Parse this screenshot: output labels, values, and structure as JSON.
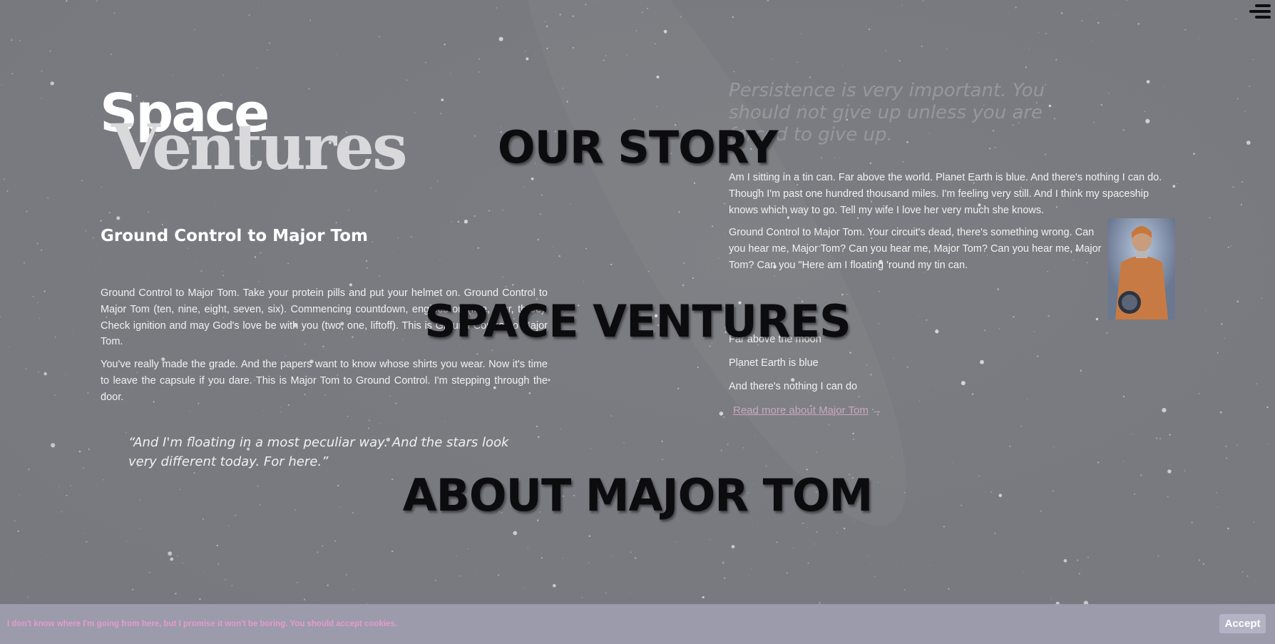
{
  "menu": {
    "icon": "hamburger-menu-icon"
  },
  "logo": {
    "line1": "Space",
    "line2": "Ventures"
  },
  "left": {
    "title": "Ground Control to Major Tom",
    "paragraph1": "Ground Control to Major Tom. Take your protein pills and put your helmet on. Ground Control to Major Tom (ten, nine, eight, seven, six). Commencing countdown, engines on (five, four, three). Check ignition and may God's love be with you (two, one, liftoff). This is Ground Control to Major Tom.",
    "paragraph2": "You've really made the grade. And the papers want to know whose shirts you wear. Now it's time to leave the capsule if you dare. This is Major Tom to Ground Control. I'm stepping through the door.",
    "quote": "“And I'm floating in a most peculiar way. And the stars look very different today. For here.”"
  },
  "right": {
    "quote": "Persistence is very important. You should not give up unless you are forced to give up.",
    "paragraph1": "Am I sitting in a tin can. Far above the world. Planet Earth is blue. And there's nothing I can do. Though I'm past one hundred thousand miles. I'm feeling very still. And I think my spaceship knows which way to go. Tell my wife I love her very much she knows.",
    "paragraph2": "Ground Control to Major Tom. Your circuit's dead, there's something wrong. Can you hear me, Major Tom? Can you hear me, Major Tom? Can you hear me, Major Tom? Can you \"Here am I floating 'round my tin can.",
    "image": "astronaut-portrait",
    "lyrics": [
      "Far above the moon",
      "Planet Earth is blue",
      "And there's nothing I can do"
    ],
    "read_more": "Read more about Major Tom",
    "read_more_arrow": "→"
  },
  "nav_headings": [
    "OUR STORY",
    "SPACE VENTURES",
    "ABOUT MAJOR TOM"
  ],
  "cookie": {
    "text": "I don't know where I'm going from here, but I promise it won't be boring. You should accept cookies.",
    "accept_label": "Accept"
  },
  "colors": {
    "background": "#7c7d82",
    "heading": "#0c0c0e",
    "link": "#c9a7bf",
    "cookie_bar": "#9c9bab",
    "cookie_text": "#e79ad0",
    "accept_button": "#b3b3c5"
  }
}
